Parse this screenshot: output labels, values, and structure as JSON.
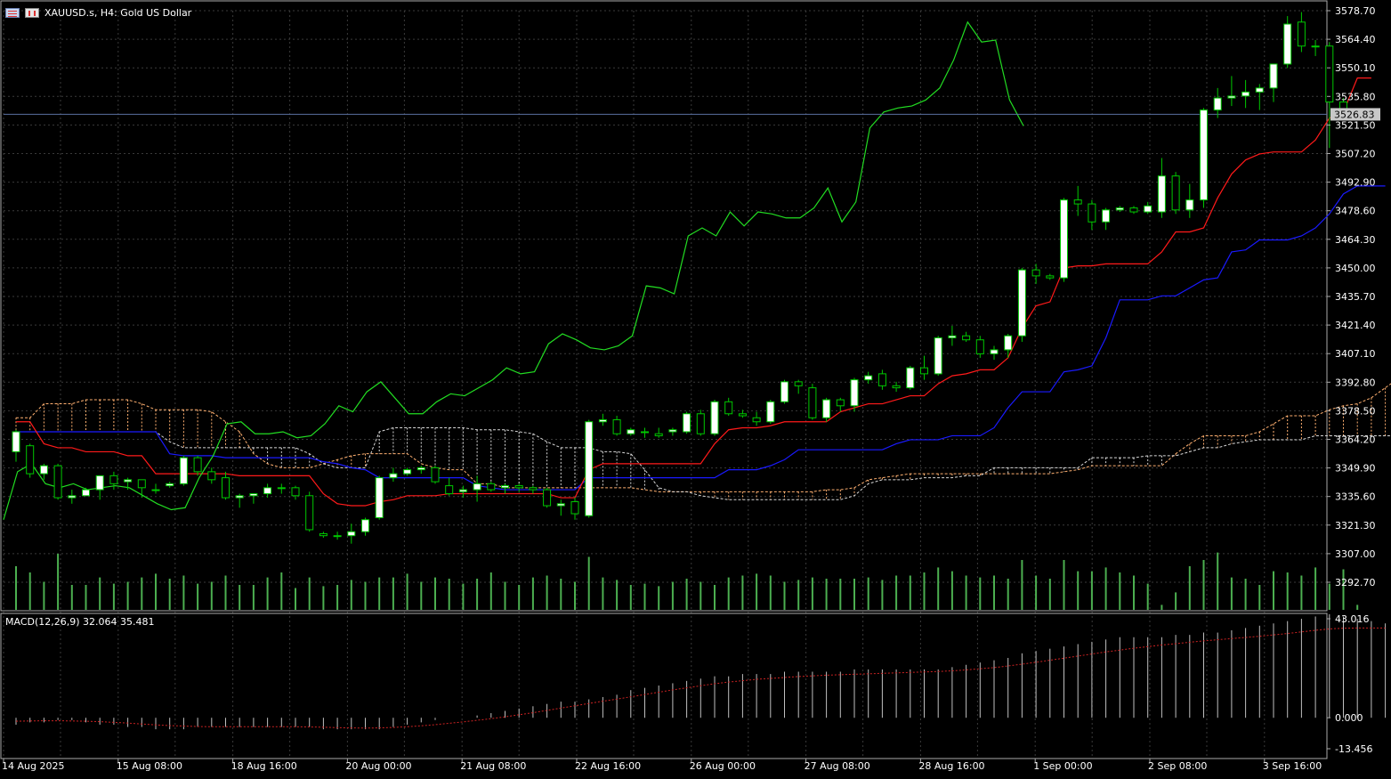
{
  "header": {
    "symbol_text": "XAUUSD.s, H4:  Gold US Dollar",
    "flag_icons": [
      "us-flag-icon",
      "chart-window-icon"
    ]
  },
  "current_price_label": "3526.83",
  "macd": {
    "label": "MACD(12,26,9) 32.064 35.481",
    "axis_labels": [
      "43.016",
      "0.000",
      "-13.456"
    ],
    "ylim": [
      -13.456,
      43.016
    ]
  },
  "colors": {
    "background": "#000000",
    "grid": "#3a3a3a",
    "bull_candle": "#ffffff",
    "bear_candle": "#000000",
    "candle_outline": "#00c800",
    "tenkan": "#ff1a1a",
    "kijun": "#1a1aff",
    "chikou": "#22dd22",
    "senkou_a": "#ffb070",
    "senkou_b": "#d8d8d8",
    "volume": "#4caf50",
    "macd_hist": "#c0c0c0",
    "macd_signal": "#cc2222",
    "price_line": "#5a6fa0"
  },
  "chart_data": {
    "type": "candlestick",
    "title": "XAUUSD.s, H4:  Gold US Dollar",
    "ylim": [
      3292.7,
      3578.7
    ],
    "y_tick_labels": [
      "3578.70",
      "3564.40",
      "3550.10",
      "3535.80",
      "3521.50",
      "3507.20",
      "3492.90",
      "3478.60",
      "3464.30",
      "3450.00",
      "3435.70",
      "3421.40",
      "3407.10",
      "3392.80",
      "3378.50",
      "3364.20",
      "3349.90",
      "3335.60",
      "3321.30",
      "3307.00",
      "3292.70"
    ],
    "x_tick_labels": [
      "14 Aug 2025",
      "15 Aug 08:00",
      "18 Aug 16:00",
      "20 Aug 00:00",
      "21 Aug 08:00",
      "22 Aug 16:00",
      "26 Aug 00:00",
      "27 Aug 08:00",
      "28 Aug 16:00",
      "1 Sep 00:00",
      "2 Sep 08:00",
      "3 Sep 16:00"
    ],
    "last_price": 3526.83,
    "candles": [
      {
        "o": 3358,
        "h": 3369,
        "l": 3353,
        "c": 3368
      },
      {
        "o": 3361,
        "h": 3362,
        "l": 3345,
        "c": 3347
      },
      {
        "o": 3347,
        "h": 3352,
        "l": 3344,
        "c": 3351
      },
      {
        "o": 3351,
        "h": 3352,
        "l": 3334,
        "c": 3335
      },
      {
        "o": 3335,
        "h": 3339,
        "l": 3332,
        "c": 3336
      },
      {
        "o": 3336,
        "h": 3340,
        "l": 3336,
        "c": 3339
      },
      {
        "o": 3339,
        "h": 3346,
        "l": 3334,
        "c": 3346
      },
      {
        "o": 3346,
        "h": 3348,
        "l": 3339,
        "c": 3342
      },
      {
        "o": 3343,
        "h": 3345,
        "l": 3339,
        "c": 3344
      },
      {
        "o": 3344,
        "h": 3344,
        "l": 3335,
        "c": 3340
      },
      {
        "o": 3339,
        "h": 3342,
        "l": 3337,
        "c": 3339
      },
      {
        "o": 3341,
        "h": 3343,
        "l": 3340,
        "c": 3342
      },
      {
        "o": 3342,
        "h": 3356,
        "l": 3341,
        "c": 3355
      },
      {
        "o": 3355,
        "h": 3356,
        "l": 3346,
        "c": 3348
      },
      {
        "o": 3348,
        "h": 3350,
        "l": 3342,
        "c": 3344
      },
      {
        "o": 3345,
        "h": 3348,
        "l": 3334,
        "c": 3335
      },
      {
        "o": 3335,
        "h": 3337,
        "l": 3330,
        "c": 3336
      },
      {
        "o": 3336,
        "h": 3337,
        "l": 3332,
        "c": 3337
      },
      {
        "o": 3337,
        "h": 3342,
        "l": 3335,
        "c": 3340
      },
      {
        "o": 3340,
        "h": 3342,
        "l": 3337,
        "c": 3340
      },
      {
        "o": 3340,
        "h": 3341,
        "l": 3334,
        "c": 3336
      },
      {
        "o": 3336,
        "h": 3338,
        "l": 3318,
        "c": 3319
      },
      {
        "o": 3317,
        "h": 3318,
        "l": 3315,
        "c": 3316
      },
      {
        "o": 3316,
        "h": 3318,
        "l": 3314,
        "c": 3316
      },
      {
        "o": 3316,
        "h": 3322,
        "l": 3312,
        "c": 3318
      },
      {
        "o": 3318,
        "h": 3325,
        "l": 3316,
        "c": 3324
      },
      {
        "o": 3325,
        "h": 3346,
        "l": 3324,
        "c": 3345
      },
      {
        "o": 3345,
        "h": 3350,
        "l": 3343,
        "c": 3347
      },
      {
        "o": 3347,
        "h": 3350,
        "l": 3346,
        "c": 3349
      },
      {
        "o": 3349,
        "h": 3351,
        "l": 3347,
        "c": 3350
      },
      {
        "o": 3350,
        "h": 3351,
        "l": 3342,
        "c": 3343
      },
      {
        "o": 3341,
        "h": 3345,
        "l": 3336,
        "c": 3337
      },
      {
        "o": 3338,
        "h": 3341,
        "l": 3335,
        "c": 3339
      },
      {
        "o": 3339,
        "h": 3346,
        "l": 3333,
        "c": 3342
      },
      {
        "o": 3342,
        "h": 3343,
        "l": 3338,
        "c": 3339
      },
      {
        "o": 3340,
        "h": 3342,
        "l": 3337,
        "c": 3341
      },
      {
        "o": 3341,
        "h": 3342,
        "l": 3338,
        "c": 3340
      },
      {
        "o": 3340,
        "h": 3341,
        "l": 3337,
        "c": 3339
      },
      {
        "o": 3339,
        "h": 3340,
        "l": 3330,
        "c": 3331
      },
      {
        "o": 3331,
        "h": 3334,
        "l": 3326,
        "c": 3332
      },
      {
        "o": 3333,
        "h": 3335,
        "l": 3324,
        "c": 3327
      },
      {
        "o": 3326,
        "h": 3374,
        "l": 3325,
        "c": 3373
      },
      {
        "o": 3373,
        "h": 3377,
        "l": 3371,
        "c": 3374
      },
      {
        "o": 3374,
        "h": 3376,
        "l": 3366,
        "c": 3367
      },
      {
        "o": 3367,
        "h": 3370,
        "l": 3366,
        "c": 3369
      },
      {
        "o": 3368,
        "h": 3370,
        "l": 3365,
        "c": 3368
      },
      {
        "o": 3367,
        "h": 3370,
        "l": 3365,
        "c": 3366
      },
      {
        "o": 3368,
        "h": 3370,
        "l": 3366,
        "c": 3369
      },
      {
        "o": 3368,
        "h": 3378,
        "l": 3367,
        "c": 3377
      },
      {
        "o": 3377,
        "h": 3379,
        "l": 3366,
        "c": 3367
      },
      {
        "o": 3367,
        "h": 3384,
        "l": 3366,
        "c": 3383
      },
      {
        "o": 3383,
        "h": 3385,
        "l": 3376,
        "c": 3377
      },
      {
        "o": 3377,
        "h": 3379,
        "l": 3375,
        "c": 3376
      },
      {
        "o": 3375,
        "h": 3378,
        "l": 3371,
        "c": 3373
      },
      {
        "o": 3373,
        "h": 3384,
        "l": 3372,
        "c": 3383
      },
      {
        "o": 3383,
        "h": 3394,
        "l": 3382,
        "c": 3393
      },
      {
        "o": 3393,
        "h": 3394,
        "l": 3387,
        "c": 3391
      },
      {
        "o": 3390,
        "h": 3392,
        "l": 3374,
        "c": 3375
      },
      {
        "o": 3375,
        "h": 3385,
        "l": 3373,
        "c": 3384
      },
      {
        "o": 3384,
        "h": 3385,
        "l": 3378,
        "c": 3381
      },
      {
        "o": 3381,
        "h": 3395,
        "l": 3378,
        "c": 3394
      },
      {
        "o": 3394,
        "h": 3398,
        "l": 3392,
        "c": 3396
      },
      {
        "o": 3397,
        "h": 3399,
        "l": 3389,
        "c": 3391
      },
      {
        "o": 3391,
        "h": 3393,
        "l": 3388,
        "c": 3390
      },
      {
        "o": 3390,
        "h": 3401,
        "l": 3389,
        "c": 3400
      },
      {
        "o": 3400,
        "h": 3406,
        "l": 3394,
        "c": 3397
      },
      {
        "o": 3397,
        "h": 3416,
        "l": 3396,
        "c": 3415
      },
      {
        "o": 3415,
        "h": 3421,
        "l": 3411,
        "c": 3416
      },
      {
        "o": 3416,
        "h": 3418,
        "l": 3413,
        "c": 3414
      },
      {
        "o": 3414,
        "h": 3416,
        "l": 3405,
        "c": 3407
      },
      {
        "o": 3407,
        "h": 3411,
        "l": 3404,
        "c": 3409
      },
      {
        "o": 3409,
        "h": 3417,
        "l": 3405,
        "c": 3416
      },
      {
        "o": 3416,
        "h": 3450,
        "l": 3413,
        "c": 3449
      },
      {
        "o": 3449,
        "h": 3452,
        "l": 3442,
        "c": 3446
      },
      {
        "o": 3446,
        "h": 3447,
        "l": 3444,
        "c": 3445
      },
      {
        "o": 3445,
        "h": 3485,
        "l": 3443,
        "c": 3484
      },
      {
        "o": 3484,
        "h": 3491,
        "l": 3476,
        "c": 3482
      },
      {
        "o": 3482,
        "h": 3484,
        "l": 3469,
        "c": 3473
      },
      {
        "o": 3473,
        "h": 3480,
        "l": 3469,
        "c": 3479
      },
      {
        "o": 3479,
        "h": 3481,
        "l": 3478,
        "c": 3480
      },
      {
        "o": 3480,
        "h": 3481,
        "l": 3477,
        "c": 3478
      },
      {
        "o": 3478,
        "h": 3483,
        "l": 3477,
        "c": 3481
      },
      {
        "o": 3478,
        "h": 3505,
        "l": 3475,
        "c": 3496
      },
      {
        "o": 3496,
        "h": 3498,
        "l": 3477,
        "c": 3479
      },
      {
        "o": 3479,
        "h": 3492,
        "l": 3475,
        "c": 3484
      },
      {
        "o": 3484,
        "h": 3530,
        "l": 3480,
        "c": 3529
      },
      {
        "o": 3529,
        "h": 3540,
        "l": 3525,
        "c": 3535
      },
      {
        "o": 3535,
        "h": 3546,
        "l": 3531,
        "c": 3536
      },
      {
        "o": 3536,
        "h": 3544,
        "l": 3530,
        "c": 3538
      },
      {
        "o": 3538,
        "h": 3542,
        "l": 3529,
        "c": 3540
      },
      {
        "o": 3540,
        "h": 3544,
        "l": 3533,
        "c": 3552
      },
      {
        "o": 3552,
        "h": 3576,
        "l": 3550,
        "c": 3572
      },
      {
        "o": 3573,
        "h": 3578,
        "l": 3558,
        "c": 3561
      },
      {
        "o": 3561,
        "h": 3564,
        "l": 3556,
        "c": 3561
      },
      {
        "o": 3561,
        "h": 3563,
        "l": 3510,
        "c": 3533
      },
      {
        "o": 3533,
        "h": 3535,
        "l": 3526,
        "c": 3527
      }
    ],
    "tenkan": [
      3373,
      3373,
      3362,
      3360,
      3360,
      3358,
      3358,
      3358,
      3356,
      3356,
      3347,
      3347,
      3347,
      3347,
      3347,
      3347,
      3346,
      3346,
      3346,
      3346,
      3346,
      3346,
      3337,
      3332,
      3331,
      3331,
      3333,
      3334,
      3336,
      3336,
      3336,
      3337,
      3337,
      3337,
      3337,
      3337,
      3337,
      3337,
      3337,
      3335,
      3335,
      3349,
      3352,
      3352,
      3352,
      3352,
      3352,
      3352,
      3352,
      3352,
      3362,
      3369,
      3370,
      3370,
      3371,
      3373,
      3373,
      3373,
      3373,
      3378,
      3380,
      3382,
      3382,
      3384,
      3386,
      3386,
      3392,
      3396,
      3397,
      3399,
      3399,
      3405,
      3420,
      3431,
      3433,
      3450,
      3451,
      3451,
      3452,
      3452,
      3452,
      3452,
      3458,
      3468,
      3468,
      3470,
      3485,
      3497,
      3504,
      3507,
      3508,
      3508,
      3508,
      3514,
      3525,
      3528,
      3545,
      3545
    ],
    "kijun": [
      3368,
      3368,
      3368,
      3368,
      3368,
      3368,
      3368,
      3368,
      3368,
      3368,
      3368,
      3357,
      3356,
      3356,
      3356,
      3355,
      3355,
      3355,
      3355,
      3355,
      3355,
      3355,
      3353,
      3352,
      3350,
      3349,
      3345,
      3345,
      3345,
      3345,
      3345,
      3345,
      3345,
      3341,
      3340,
      3339,
      3339,
      3339,
      3339,
      3339,
      3339,
      3345,
      3345,
      3345,
      3345,
      3345,
      3345,
      3345,
      3345,
      3345,
      3345,
      3349,
      3349,
      3349,
      3351,
      3354,
      3359,
      3359,
      3359,
      3359,
      3359,
      3359,
      3359,
      3362,
      3364,
      3364,
      3364,
      3366,
      3366,
      3366,
      3370,
      3380,
      3388,
      3388,
      3388,
      3398,
      3399,
      3401,
      3415,
      3434,
      3434,
      3434,
      3436,
      3436,
      3440,
      3444,
      3445,
      3458,
      3459,
      3464,
      3464,
      3464,
      3466,
      3470,
      3477,
      3487,
      3491,
      3491,
      3491
    ],
    "chikou": [
      3324,
      3348,
      3352,
      3342,
      3340,
      3342,
      3339,
      3340,
      3341,
      3340,
      3336,
      3332,
      3329,
      3330,
      3345,
      3356,
      3372,
      3373,
      3367,
      3367,
      3368,
      3365,
      3366,
      3372,
      3381,
      3378,
      3388,
      3393,
      3385,
      3377,
      3377,
      3383,
      3387,
      3386,
      3390,
      3394,
      3400,
      3397,
      3398,
      3412,
      3417,
      3414,
      3410,
      3409,
      3411,
      3416,
      3441,
      3440,
      3437,
      3466,
      3470,
      3466,
      3478,
      3471,
      3478,
      3477,
      3475,
      3475,
      3480,
      3490,
      3473,
      3483,
      3520,
      3528,
      3530,
      3531,
      3534,
      3540,
      3554,
      3573,
      3563,
      3564,
      3534,
      3521
    ],
    "senkou_a": [
      3375,
      3375,
      3382,
      3382,
      3382,
      3384,
      3384,
      3384,
      3384,
      3382,
      3379,
      3379,
      3379,
      3379,
      3378,
      3373,
      3368,
      3357,
      3352,
      3350,
      3350,
      3350,
      3352,
      3354,
      3356,
      3357,
      3357,
      3357,
      3357,
      3352,
      3350,
      3349,
      3349,
      3342,
      3342,
      3340,
      3340,
      3340,
      3340,
      3340,
      3340,
      3340,
      3340,
      3340,
      3340,
      3339,
      3338,
      3338,
      3338,
      3338,
      3338,
      3338,
      3338,
      3338,
      3338,
      3338,
      3338,
      3338,
      3339,
      3339,
      3340,
      3344,
      3345,
      3346,
      3347,
      3347,
      3347,
      3347,
      3347,
      3347,
      3347,
      3347,
      3347,
      3347,
      3347,
      3348,
      3349,
      3351,
      3351,
      3351,
      3351,
      3351,
      3351,
      3357,
      3362,
      3366,
      3366,
      3366,
      3366,
      3368,
      3372,
      3376,
      3376,
      3376,
      3379,
      3381,
      3382,
      3385,
      3390,
      3395,
      3395
    ],
    "senkou_b": [
      3368,
      3368,
      3368,
      3368,
      3368,
      3368,
      3368,
      3368,
      3368,
      3368,
      3368,
      3363,
      3360,
      3360,
      3360,
      3360,
      3360,
      3360,
      3360,
      3360,
      3360,
      3357,
      3352,
      3350,
      3350,
      3350,
      3368,
      3370,
      3370,
      3370,
      3370,
      3370,
      3370,
      3369,
      3369,
      3369,
      3368,
      3367,
      3363,
      3360,
      3360,
      3360,
      3358,
      3358,
      3357,
      3349,
      3340,
      3338,
      3338,
      3336,
      3335,
      3334,
      3334,
      3334,
      3334,
      3334,
      3334,
      3334,
      3334,
      3334,
      3336,
      3342,
      3344,
      3344,
      3344,
      3345,
      3345,
      3345,
      3346,
      3346,
      3350,
      3350,
      3350,
      3350,
      3350,
      3350,
      3350,
      3355,
      3355,
      3355,
      3355,
      3356,
      3356,
      3356,
      3358,
      3360,
      3360,
      3362,
      3363,
      3364,
      3364,
      3364,
      3364,
      3366,
      3366,
      3366,
      3366,
      3366,
      3366,
      3366
    ],
    "volume": [
      70,
      60,
      45,
      90,
      40,
      40,
      52,
      42,
      45,
      52,
      58,
      50,
      55,
      42,
      45,
      55,
      40,
      40,
      52,
      60,
      35,
      52,
      38,
      40,
      48,
      45,
      52,
      52,
      58,
      45,
      52,
      50,
      42,
      50,
      60,
      45,
      40,
      52,
      55,
      50,
      45,
      85,
      52,
      48,
      40,
      42,
      38,
      45,
      50,
      45,
      40,
      52,
      55,
      58,
      55,
      45,
      48,
      52,
      50,
      50,
      50,
      52,
      48,
      55,
      55,
      60,
      68,
      62,
      55,
      52,
      55,
      50,
      80,
      55,
      50,
      80,
      62,
      62,
      68,
      60,
      55,
      42,
      8,
      28,
      70,
      80,
      92,
      52,
      50,
      40,
      62,
      60,
      55,
      68,
      42,
      65,
      8
    ],
    "macd_hist": [
      -3,
      -2,
      -2,
      -1,
      -1,
      -2,
      -3,
      -3,
      -4,
      -4,
      -5,
      -5,
      -5,
      -4,
      -4,
      -4,
      -4,
      -4,
      -4,
      -4,
      -4,
      -4,
      -5,
      -5,
      -5,
      -5,
      -5,
      -4,
      -3,
      -2,
      -1,
      0,
      0,
      1,
      2,
      3,
      4,
      5,
      6,
      7,
      7,
      8,
      9,
      10,
      12,
      13,
      14,
      15,
      16,
      17,
      18,
      18,
      19,
      19,
      19,
      20,
      20,
      20,
      20,
      20,
      21,
      21,
      21,
      21,
      21,
      21,
      21,
      22,
      23,
      24,
      25,
      26,
      28,
      29,
      30,
      31,
      32,
      33,
      34,
      35,
      35,
      35,
      35,
      36,
      36,
      37,
      37,
      38,
      39,
      40,
      41,
      42,
      43,
      44,
      45,
      44,
      43,
      42,
      41
    ],
    "macd_signal": [
      -1.5,
      -1.4,
      -1.3,
      -1.3,
      -1.4,
      -1.5,
      -1.7,
      -2.0,
      -2.3,
      -2.7,
      -3.1,
      -3.4,
      -3.6,
      -3.8,
      -3.9,
      -3.9,
      -3.9,
      -3.9,
      -3.9,
      -3.9,
      -3.9,
      -4.0,
      -4.1,
      -4.3,
      -4.4,
      -4.5,
      -4.4,
      -4.2,
      -3.9,
      -3.5,
      -3.0,
      -2.4,
      -1.8,
      -1.1,
      -0.4,
      0.4,
      1.3,
      2.2,
      3.2,
      4.2,
      5.2,
      6.2,
      7.2,
      8.1,
      9.1,
      10.1,
      11.1,
      12.1,
      13.0,
      13.9,
      14.8,
      15.5,
      16.1,
      16.7,
      17.1,
      17.5,
      17.9,
      18.2,
      18.5,
      18.7,
      18.9,
      19.1,
      19.3,
      19.5,
      19.7,
      19.9,
      20.1,
      20.4,
      20.8,
      21.3,
      21.8,
      22.5,
      23.3,
      24.1,
      25.0,
      25.9,
      26.8,
      27.7,
      28.6,
      29.4,
      30.2,
      30.9,
      31.6,
      32.2,
      32.8,
      33.4,
      33.9,
      34.4,
      34.9,
      35.4,
      36.0,
      36.6,
      37.3,
      38.0,
      38.6,
      38.9,
      39.0,
      39.0,
      39.0
    ]
  }
}
